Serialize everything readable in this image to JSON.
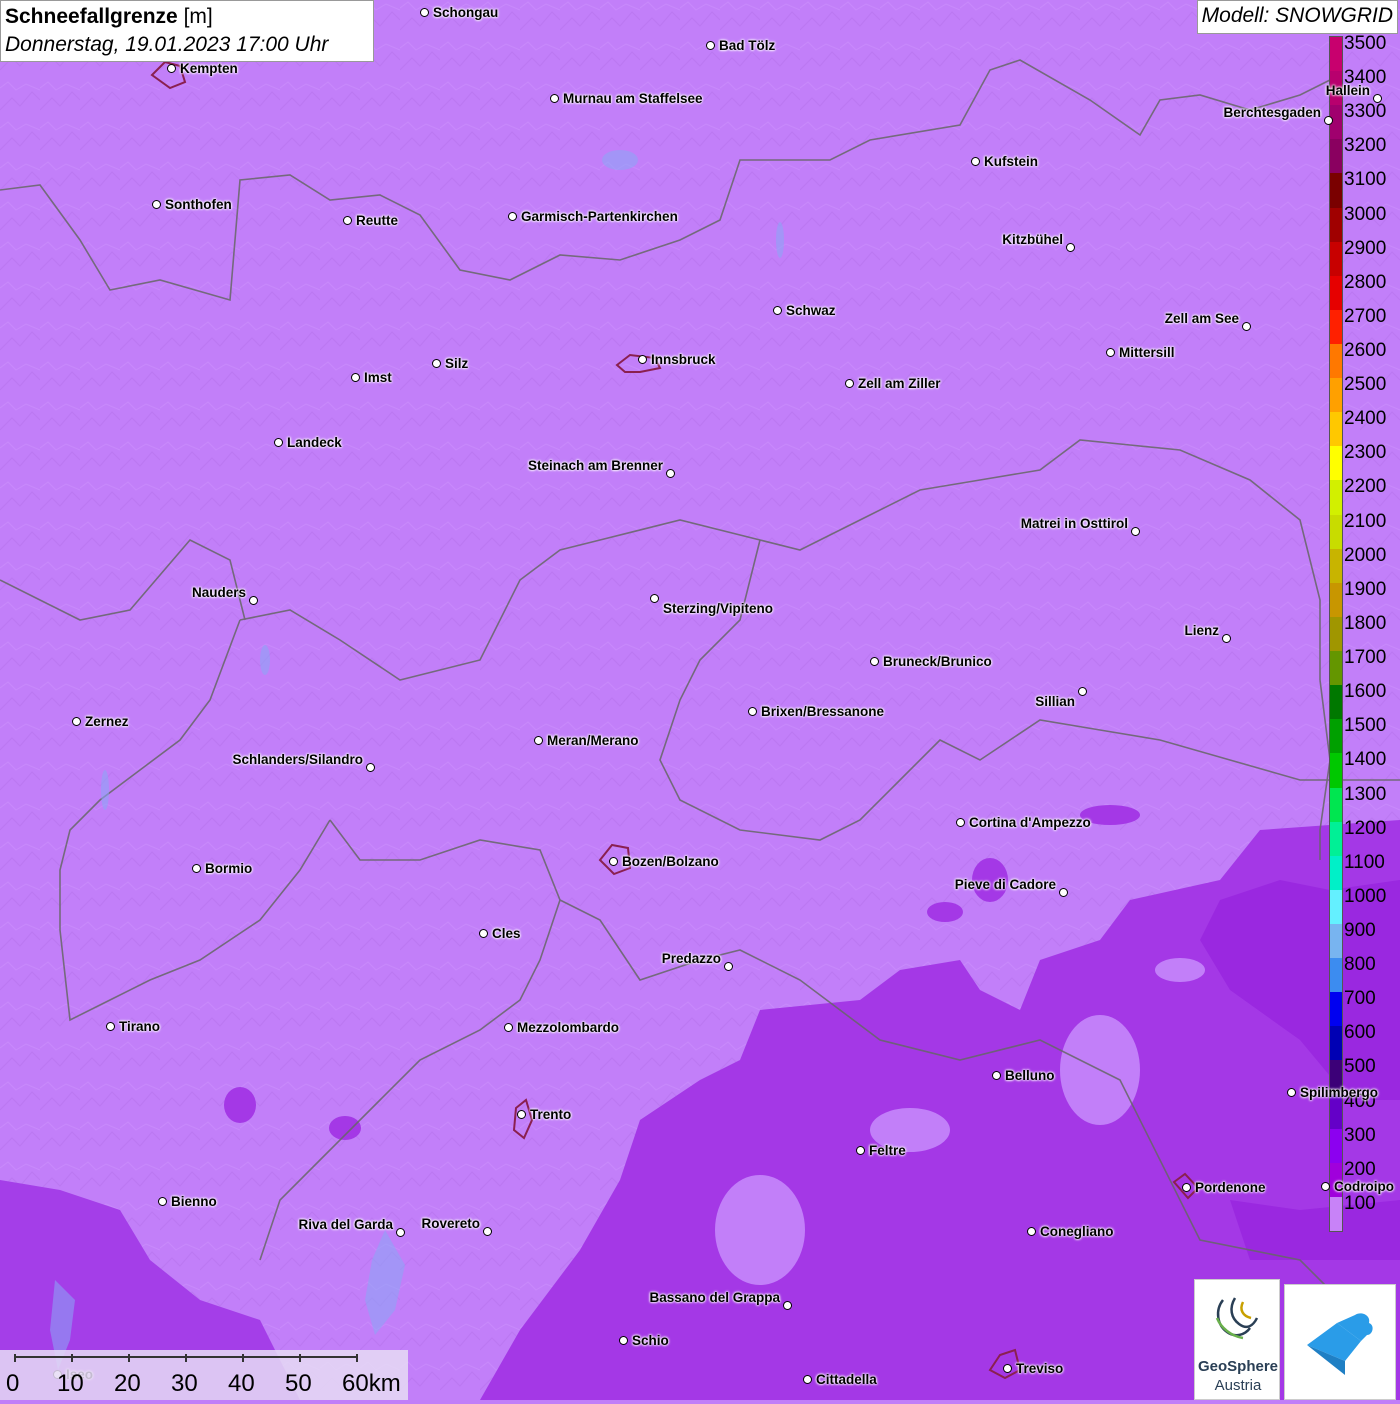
{
  "header": {
    "title_bold": "Schneefallgrenze",
    "title_unit": "[m]",
    "datetime": "Donnerstag, 19.01.2023 17:00 Uhr",
    "model": "Modell: SNOWGRID"
  },
  "legend": {
    "entries": [
      {
        "label": "3500",
        "color": "#c8006e"
      },
      {
        "label": "3400",
        "color": "#b8006e"
      },
      {
        "label": "3300",
        "color": "#a0006e"
      },
      {
        "label": "3200",
        "color": "#8a0060"
      },
      {
        "label": "3100",
        "color": "#7a0000"
      },
      {
        "label": "3000",
        "color": "#a00000"
      },
      {
        "label": "2900",
        "color": "#c80000"
      },
      {
        "label": "2800",
        "color": "#e60000"
      },
      {
        "label": "2700",
        "color": "#ff2000"
      },
      {
        "label": "2600",
        "color": "#ff7800"
      },
      {
        "label": "2500",
        "color": "#ffa000"
      },
      {
        "label": "2400",
        "color": "#ffc800"
      },
      {
        "label": "2300",
        "color": "#ffff00"
      },
      {
        "label": "2200",
        "color": "#d2f000"
      },
      {
        "label": "2100",
        "color": "#c8dc00"
      },
      {
        "label": "2000",
        "color": "#c8b400"
      },
      {
        "label": "1900",
        "color": "#c89600"
      },
      {
        "label": "1800",
        "color": "#a09600"
      },
      {
        "label": "1700",
        "color": "#649600"
      },
      {
        "label": "1600",
        "color": "#007800"
      },
      {
        "label": "1500",
        "color": "#00a000"
      },
      {
        "label": "1400",
        "color": "#00c800"
      },
      {
        "label": "1300",
        "color": "#00e650"
      },
      {
        "label": "1200",
        "color": "#00f096"
      },
      {
        "label": "1100",
        "color": "#00f0c8"
      },
      {
        "label": "1000",
        "color": "#64f0ff"
      },
      {
        "label": "900",
        "color": "#78b4f0"
      },
      {
        "label": "800",
        "color": "#3c8cf0"
      },
      {
        "label": "700",
        "color": "#0000f0"
      },
      {
        "label": "600",
        "color": "#0000b4"
      },
      {
        "label": "500",
        "color": "#3c0078"
      },
      {
        "label": "400",
        "color": "#6400c8"
      },
      {
        "label": "300",
        "color": "#8c00f0"
      },
      {
        "label": "200",
        "color": "#a000dc"
      },
      {
        "label": "100",
        "color": "#c882f8"
      }
    ]
  },
  "cities": [
    {
      "name": "Schongau"
    },
    {
      "name": "Bad Tölz"
    },
    {
      "name": "Kempten"
    },
    {
      "name": "Murnau am Staffelsee"
    },
    {
      "name": "Hallein"
    },
    {
      "name": "Berchtesgaden"
    },
    {
      "name": "Kufstein"
    },
    {
      "name": "Sonthofen"
    },
    {
      "name": "Reutte"
    },
    {
      "name": "Garmisch-Partenkirchen"
    },
    {
      "name": "Kitzbühel"
    },
    {
      "name": "Schwaz"
    },
    {
      "name": "Zell am See"
    },
    {
      "name": "Innsbruck"
    },
    {
      "name": "Mittersill"
    },
    {
      "name": "Silz"
    },
    {
      "name": "Imst"
    },
    {
      "name": "Zell am Ziller"
    },
    {
      "name": "Landeck"
    },
    {
      "name": "Steinach am Brenner"
    },
    {
      "name": "Matrei in Osttirol"
    },
    {
      "name": "Nauders"
    },
    {
      "name": "Sterzing/Vipiteno"
    },
    {
      "name": "Lienz"
    },
    {
      "name": "Bruneck/Brunico"
    },
    {
      "name": "Sillian"
    },
    {
      "name": "Brixen/Bressanone"
    },
    {
      "name": "Zernez"
    },
    {
      "name": "Meran/Merano"
    },
    {
      "name": "Schlanders/Silandro"
    },
    {
      "name": "Cortina d'Ampezzo"
    },
    {
      "name": "Bozen/Bolzano"
    },
    {
      "name": "Bormio"
    },
    {
      "name": "Pieve di Cadore"
    },
    {
      "name": "Cles"
    },
    {
      "name": "Predazzo"
    },
    {
      "name": "Tirano"
    },
    {
      "name": "Mezzolombardo"
    },
    {
      "name": "Belluno"
    },
    {
      "name": "Spilimbergo"
    },
    {
      "name": "Trento"
    },
    {
      "name": "Feltre"
    },
    {
      "name": "Pordenone"
    },
    {
      "name": "Codroipo"
    },
    {
      "name": "Bienno"
    },
    {
      "name": "Riva del Garda"
    },
    {
      "name": "Rovereto"
    },
    {
      "name": "Conegliano"
    },
    {
      "name": "Bassano del Grappa"
    },
    {
      "name": "Schio"
    },
    {
      "name": "Iseo"
    },
    {
      "name": "Treviso"
    },
    {
      "name": "Cittadella"
    }
  ],
  "scalebar": {
    "labels": [
      "0",
      "10",
      "20",
      "30",
      "40",
      "50",
      "60km"
    ]
  },
  "logos": {
    "geosphere_line1": "GeoSphere",
    "geosphere_line2": "Austria"
  }
}
